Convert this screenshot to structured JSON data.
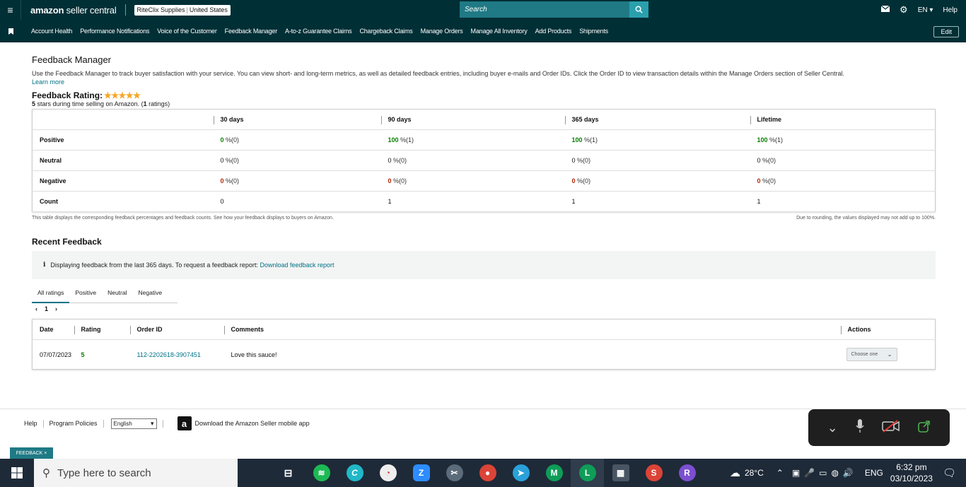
{
  "header": {
    "logo_brand": "amazon",
    "logo_rest": " seller central",
    "store_name": "RiteClix Supplies",
    "store_country": "United States",
    "search_placeholder": "Search",
    "language": "EN",
    "help": "Help"
  },
  "nav": {
    "items": [
      "Account Health",
      "Performance Notifications",
      "Voice of the Customer",
      "Feedback Manager",
      "A-to-z Guarantee Claims",
      "Chargeback Claims",
      "Manage Orders",
      "Manage All Inventory",
      "Add Products",
      "Shipments"
    ],
    "edit": "Edit"
  },
  "page": {
    "title": "Feedback Manager",
    "intro": "Use the Feedback Manager to track buyer satisfaction with your service. You can view short- and long-term metrics, as well as detailed feedback entries, including buyer e-mails and Order IDs. Click the Order ID to view transaction details within the Manage Orders section of Seller Central.",
    "learn_more": "Learn more",
    "rating_label": "Feedback Rating:",
    "rating_stars": "★★★★★",
    "rating_value": 5,
    "rating_sub_stars": "5",
    "rating_sub_mid": " stars during time selling on Amazon. (",
    "rating_sub_count": "1",
    "rating_sub_end": " ratings)"
  },
  "metrics": {
    "columns": [
      "30 days",
      "90 days",
      "365 days",
      "Lifetime"
    ],
    "rows": {
      "positive": {
        "label": "Positive",
        "values": [
          "0",
          "100",
          "100",
          "100"
        ],
        "counts": [
          "%(0)",
          "%(1)",
          "%(1)",
          "%(1)"
        ]
      },
      "neutral": {
        "label": "Neutral",
        "values": [
          "0",
          "0",
          "0",
          "0"
        ],
        "counts": [
          "%(0)",
          "%(0)",
          "%(0)",
          "%(0)"
        ]
      },
      "negative": {
        "label": "Negative",
        "values": [
          "0",
          "0",
          "0",
          "0"
        ],
        "counts": [
          "%(0)",
          "%(0)",
          "%(0)",
          "%(0)"
        ]
      },
      "count": {
        "label": "Count",
        "values": [
          "0",
          "1",
          "1",
          "1"
        ]
      }
    },
    "note_left": "This table displays the corresponding feedback percentages and feedback counts.",
    "note_link": "See how your feedback displays to buyers on Amazon.",
    "note_right": "Due to rounding, the values displayed may not add up to 100%."
  },
  "recent": {
    "title": "Recent Feedback",
    "info_text": "Displaying feedback from the last 365 days. To request a feedback report:",
    "info_link": "Download feedback report",
    "tabs": [
      "All ratings",
      "Positive",
      "Neutral",
      "Negative"
    ],
    "active_tab": "All ratings",
    "page_number": "1",
    "columns": [
      "Date",
      "Rating",
      "Order ID",
      "Comments",
      "Actions"
    ],
    "rows": [
      {
        "date": "07/07/2023",
        "rating": "5",
        "order_id": "112-2202618-3907451",
        "comment": "Love this sauce!",
        "action": "Choose one"
      }
    ]
  },
  "footer": {
    "help": "Help",
    "policies": "Program Policies",
    "language": "English",
    "app_text": "Download the Amazon Seller mobile app",
    "feedback_tab": "FEEDBACK"
  },
  "taskbar": {
    "search_placeholder": "Type here to search",
    "temperature": "28°C",
    "language": "ENG",
    "time": "6:32 pm",
    "date": "03/10/2023"
  },
  "colors": {
    "header_bg": "#002f36",
    "accent": "#007185",
    "positive": "#067d00",
    "negative": "#b12704",
    "star": "#f5a623"
  }
}
